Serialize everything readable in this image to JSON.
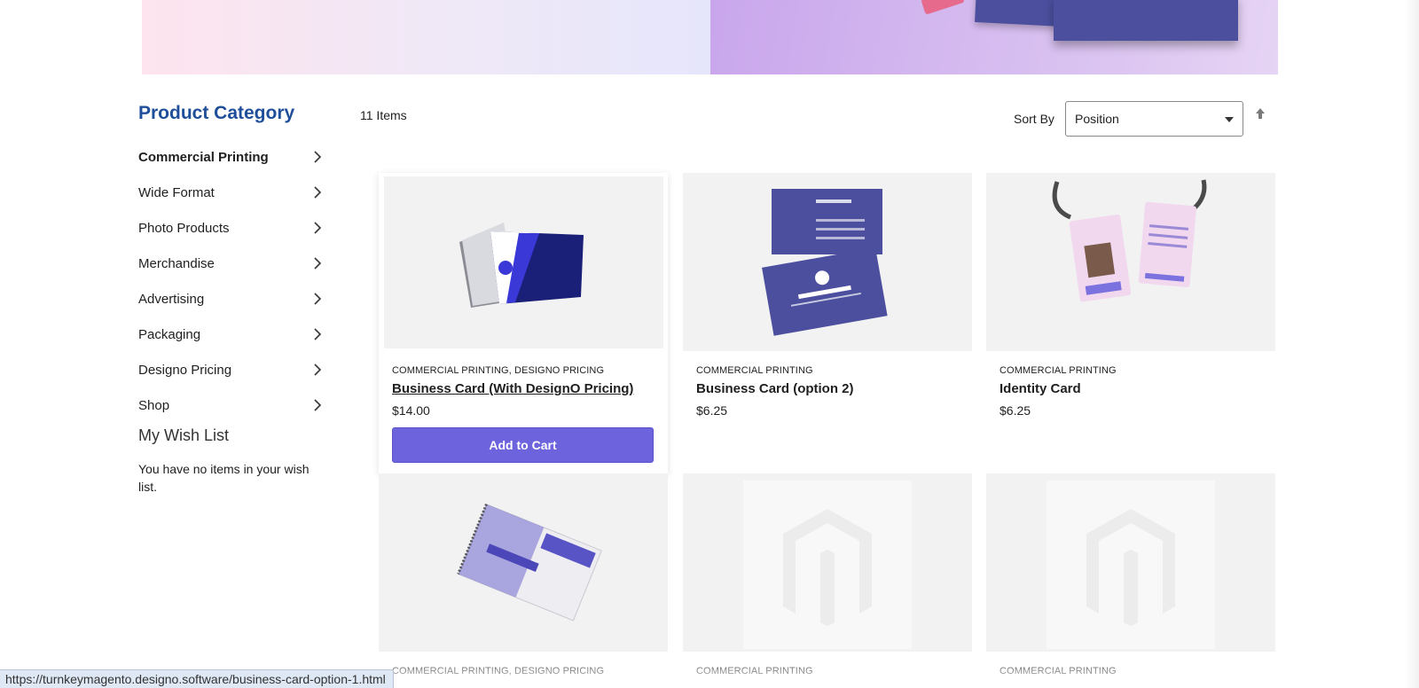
{
  "sidebar": {
    "title": "Product Category",
    "categories": [
      {
        "label": "Commercial Printing"
      },
      {
        "label": "Wide Format"
      },
      {
        "label": "Photo Products"
      },
      {
        "label": "Merchandise"
      },
      {
        "label": "Advertising"
      },
      {
        "label": "Packaging"
      },
      {
        "label": "Designo Pricing"
      },
      {
        "label": "Shop"
      }
    ],
    "wishlist": {
      "title": "My Wish List",
      "empty_text": "You have no items in your wish list."
    }
  },
  "toolbar": {
    "items_count": "11 Items",
    "sort_label": "Sort By",
    "sort_value": "Position"
  },
  "products": [
    {
      "category": "COMMERCIAL PRINTING, DESIGNO PRICING",
      "name": "Business Card (With DesignO Pricing)",
      "price": "$14.00",
      "button": "Add to Cart",
      "image": "business-card-image"
    },
    {
      "category": "COMMERCIAL PRINTING",
      "name": "Business Card (option 2)",
      "price": "$6.25",
      "image": "business-card-option-2-image"
    },
    {
      "category": "COMMERCIAL PRINTING",
      "name": "Identity Card",
      "price": "$6.25",
      "image": "identity-card-image"
    },
    {
      "category": "COMMERCIAL PRINTING, DESIGNO PRICING",
      "name": "",
      "image": "spiral-notebook-image"
    },
    {
      "category": "COMMERCIAL PRINTING",
      "name": "",
      "image": "placeholder-image"
    },
    {
      "category": "COMMERCIAL PRINTING",
      "name": "",
      "image": "placeholder-image"
    }
  ],
  "status_bar": {
    "url": "https://turnkeymagento.designo.software/business-card-option-1.html"
  },
  "colors": {
    "category_title": "#1f4e9a",
    "add_to_cart": "#6c63dd",
    "card_blue": "#4b4f9e"
  }
}
